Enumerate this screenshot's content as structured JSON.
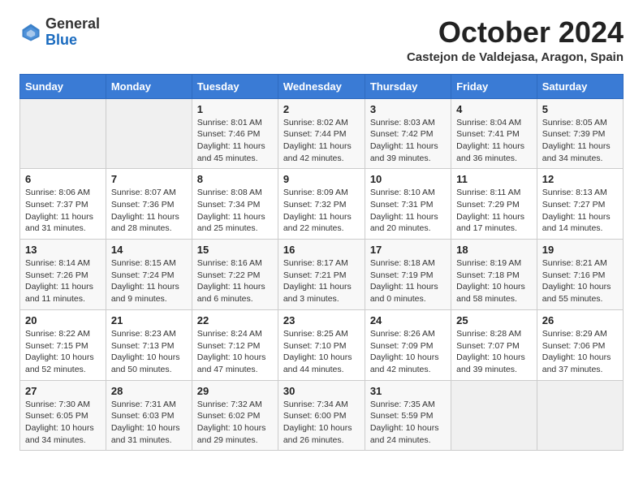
{
  "header": {
    "logo_general": "General",
    "logo_blue": "Blue",
    "month_year": "October 2024",
    "location": "Castejon de Valdejasa, Aragon, Spain"
  },
  "weekdays": [
    "Sunday",
    "Monday",
    "Tuesday",
    "Wednesday",
    "Thursday",
    "Friday",
    "Saturday"
  ],
  "weeks": [
    [
      {
        "day": "",
        "info": ""
      },
      {
        "day": "",
        "info": ""
      },
      {
        "day": "1",
        "info": "Sunrise: 8:01 AM\nSunset: 7:46 PM\nDaylight: 11 hours and 45 minutes."
      },
      {
        "day": "2",
        "info": "Sunrise: 8:02 AM\nSunset: 7:44 PM\nDaylight: 11 hours and 42 minutes."
      },
      {
        "day": "3",
        "info": "Sunrise: 8:03 AM\nSunset: 7:42 PM\nDaylight: 11 hours and 39 minutes."
      },
      {
        "day": "4",
        "info": "Sunrise: 8:04 AM\nSunset: 7:41 PM\nDaylight: 11 hours and 36 minutes."
      },
      {
        "day": "5",
        "info": "Sunrise: 8:05 AM\nSunset: 7:39 PM\nDaylight: 11 hours and 34 minutes."
      }
    ],
    [
      {
        "day": "6",
        "info": "Sunrise: 8:06 AM\nSunset: 7:37 PM\nDaylight: 11 hours and 31 minutes."
      },
      {
        "day": "7",
        "info": "Sunrise: 8:07 AM\nSunset: 7:36 PM\nDaylight: 11 hours and 28 minutes."
      },
      {
        "day": "8",
        "info": "Sunrise: 8:08 AM\nSunset: 7:34 PM\nDaylight: 11 hours and 25 minutes."
      },
      {
        "day": "9",
        "info": "Sunrise: 8:09 AM\nSunset: 7:32 PM\nDaylight: 11 hours and 22 minutes."
      },
      {
        "day": "10",
        "info": "Sunrise: 8:10 AM\nSunset: 7:31 PM\nDaylight: 11 hours and 20 minutes."
      },
      {
        "day": "11",
        "info": "Sunrise: 8:11 AM\nSunset: 7:29 PM\nDaylight: 11 hours and 17 minutes."
      },
      {
        "day": "12",
        "info": "Sunrise: 8:13 AM\nSunset: 7:27 PM\nDaylight: 11 hours and 14 minutes."
      }
    ],
    [
      {
        "day": "13",
        "info": "Sunrise: 8:14 AM\nSunset: 7:26 PM\nDaylight: 11 hours and 11 minutes."
      },
      {
        "day": "14",
        "info": "Sunrise: 8:15 AM\nSunset: 7:24 PM\nDaylight: 11 hours and 9 minutes."
      },
      {
        "day": "15",
        "info": "Sunrise: 8:16 AM\nSunset: 7:22 PM\nDaylight: 11 hours and 6 minutes."
      },
      {
        "day": "16",
        "info": "Sunrise: 8:17 AM\nSunset: 7:21 PM\nDaylight: 11 hours and 3 minutes."
      },
      {
        "day": "17",
        "info": "Sunrise: 8:18 AM\nSunset: 7:19 PM\nDaylight: 11 hours and 0 minutes."
      },
      {
        "day": "18",
        "info": "Sunrise: 8:19 AM\nSunset: 7:18 PM\nDaylight: 10 hours and 58 minutes."
      },
      {
        "day": "19",
        "info": "Sunrise: 8:21 AM\nSunset: 7:16 PM\nDaylight: 10 hours and 55 minutes."
      }
    ],
    [
      {
        "day": "20",
        "info": "Sunrise: 8:22 AM\nSunset: 7:15 PM\nDaylight: 10 hours and 52 minutes."
      },
      {
        "day": "21",
        "info": "Sunrise: 8:23 AM\nSunset: 7:13 PM\nDaylight: 10 hours and 50 minutes."
      },
      {
        "day": "22",
        "info": "Sunrise: 8:24 AM\nSunset: 7:12 PM\nDaylight: 10 hours and 47 minutes."
      },
      {
        "day": "23",
        "info": "Sunrise: 8:25 AM\nSunset: 7:10 PM\nDaylight: 10 hours and 44 minutes."
      },
      {
        "day": "24",
        "info": "Sunrise: 8:26 AM\nSunset: 7:09 PM\nDaylight: 10 hours and 42 minutes."
      },
      {
        "day": "25",
        "info": "Sunrise: 8:28 AM\nSunset: 7:07 PM\nDaylight: 10 hours and 39 minutes."
      },
      {
        "day": "26",
        "info": "Sunrise: 8:29 AM\nSunset: 7:06 PM\nDaylight: 10 hours and 37 minutes."
      }
    ],
    [
      {
        "day": "27",
        "info": "Sunrise: 7:30 AM\nSunset: 6:05 PM\nDaylight: 10 hours and 34 minutes."
      },
      {
        "day": "28",
        "info": "Sunrise: 7:31 AM\nSunset: 6:03 PM\nDaylight: 10 hours and 31 minutes."
      },
      {
        "day": "29",
        "info": "Sunrise: 7:32 AM\nSunset: 6:02 PM\nDaylight: 10 hours and 29 minutes."
      },
      {
        "day": "30",
        "info": "Sunrise: 7:34 AM\nSunset: 6:00 PM\nDaylight: 10 hours and 26 minutes."
      },
      {
        "day": "31",
        "info": "Sunrise: 7:35 AM\nSunset: 5:59 PM\nDaylight: 10 hours and 24 minutes."
      },
      {
        "day": "",
        "info": ""
      },
      {
        "day": "",
        "info": ""
      }
    ]
  ]
}
